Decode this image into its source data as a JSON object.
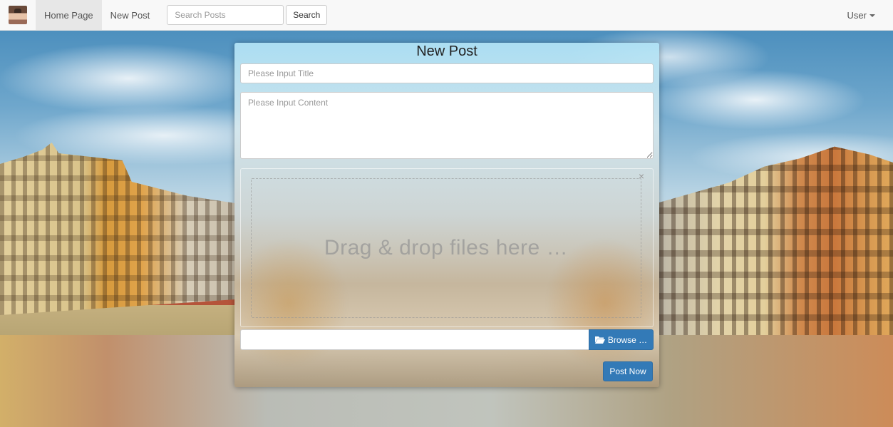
{
  "navbar": {
    "home_label": "Home Page",
    "new_post_label": "New Post",
    "search_placeholder": "Search Posts",
    "search_button_label": "Search",
    "user_label": "User"
  },
  "post_form": {
    "title": "New Post",
    "title_placeholder": "Please Input Title",
    "content_placeholder": "Please Input Content",
    "dropzone_text": "Drag & drop files here …",
    "close_label": "×",
    "browse_label": "Browse …",
    "submit_label": "Post Now"
  },
  "icons": {
    "avatar": "avatar-image",
    "caret": "caret-down-icon",
    "folder": "folder-open-icon",
    "close": "close-icon"
  },
  "colors": {
    "primary": "#337ab7",
    "navbar_bg": "#f8f8f8",
    "nav_active_bg": "#e7e7e7"
  }
}
